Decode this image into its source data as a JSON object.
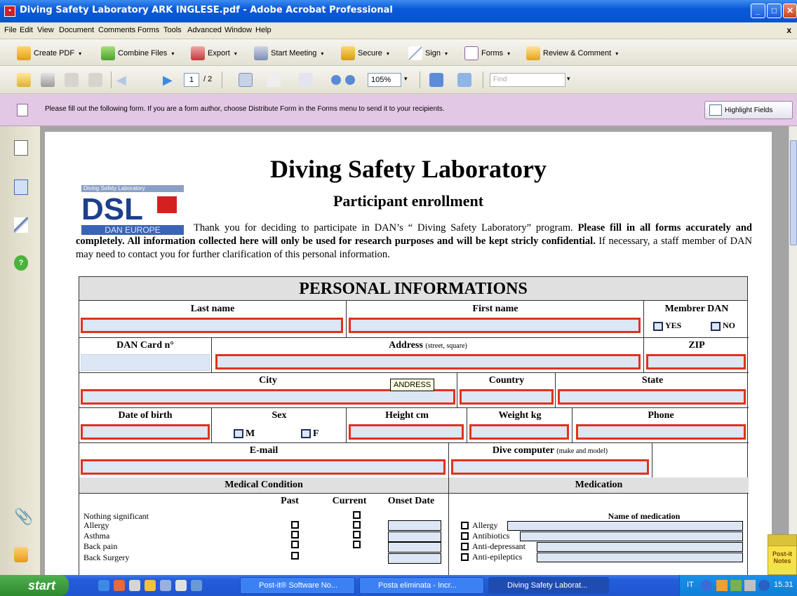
{
  "window": {
    "title": "Diving Safety Laboratory ARK INGLESE.pdf - Adobe Acrobat Professional"
  },
  "menu": [
    "File",
    "Edit",
    "View",
    "Document",
    "Comments",
    "Forms",
    "Tools",
    "Advanced",
    "Window",
    "Help"
  ],
  "menu_close": "x",
  "toolbar1": {
    "create_pdf": "Create PDF",
    "combine_files": "Combine Files",
    "export": "Export",
    "start_meeting": "Start Meeting",
    "secure": "Secure",
    "sign": "Sign",
    "forms": "Forms",
    "review_comment": "Review & Comment"
  },
  "toolbar2": {
    "page_current": "1",
    "page_total": "/ 2",
    "zoom": "105%",
    "find_placeholder": "Find"
  },
  "formbar": {
    "message": "Please fill out the following form. If you are a form author, choose Distribute Form in the Forms menu to send it to your recipients.",
    "highlight_fields": "Highlight Fields"
  },
  "document": {
    "title": "Diving Safety Laboratory",
    "subtitle": "Participant enrollment",
    "logo_top": "Diving Safety Laboratory",
    "logo_main": "DSL",
    "logo_bottom": "DAN EUROPE",
    "intro_1": "Thank you for deciding to participate in DAN’s “ Diving Safety Laboratory” program. ",
    "intro_2": "Please fill in all forms accurately and completely. All information collected here will only be used for research purposes and will be kept stricly confidential.",
    "intro_3": " If necessary, a staff member of  DAN may need to contact you for further clarification of this personal information."
  },
  "form": {
    "section_title": "PERSONAL INFORMATIONS",
    "last_name": "Last name",
    "first_name": "First name",
    "member_dan": "Membrer DAN",
    "yes": "YES",
    "no": "NO",
    "dan_card": "DAN Card n°",
    "address": "Address",
    "address_hint": "(street, square)",
    "zip": "ZIP",
    "city": "City",
    "country": "Country",
    "state": "State",
    "tooltip": "ANDRESS",
    "dob": "Date of birth",
    "sex": "Sex",
    "male": "M",
    "female": "F",
    "height": "Height cm",
    "weight": "Weight kg",
    "phone": "Phone",
    "email": "E-mail",
    "dive_computer": "Dive computer",
    "dive_computer_hint": "(make and model)",
    "medical_condition": "Medical Condition",
    "medication": "Medication",
    "past": "Past",
    "current": "Current",
    "onset_date": "Onset Date",
    "name_of_medication": "Name of medication",
    "conditions": [
      "Nothing significant",
      "Allergy",
      "Asthma",
      "Back pain",
      "Back Surgery"
    ],
    "medications": [
      "Allergy",
      "Antibiotics",
      "Anti-depressant",
      "Anti-epileptics"
    ]
  },
  "postit": {
    "line1": "Post-it",
    "line2": "Notes"
  },
  "taskbar": {
    "start": "start",
    "tasks": [
      "Post-it® Software No...",
      "Posta eliminata - Incr...",
      "Diving Safety Laborat..."
    ],
    "lang": "IT",
    "time": "15.31"
  },
  "colors": {
    "field_border": "#e0321e",
    "field_fill": "#dde6f5",
    "accent": "#0553cf"
  }
}
